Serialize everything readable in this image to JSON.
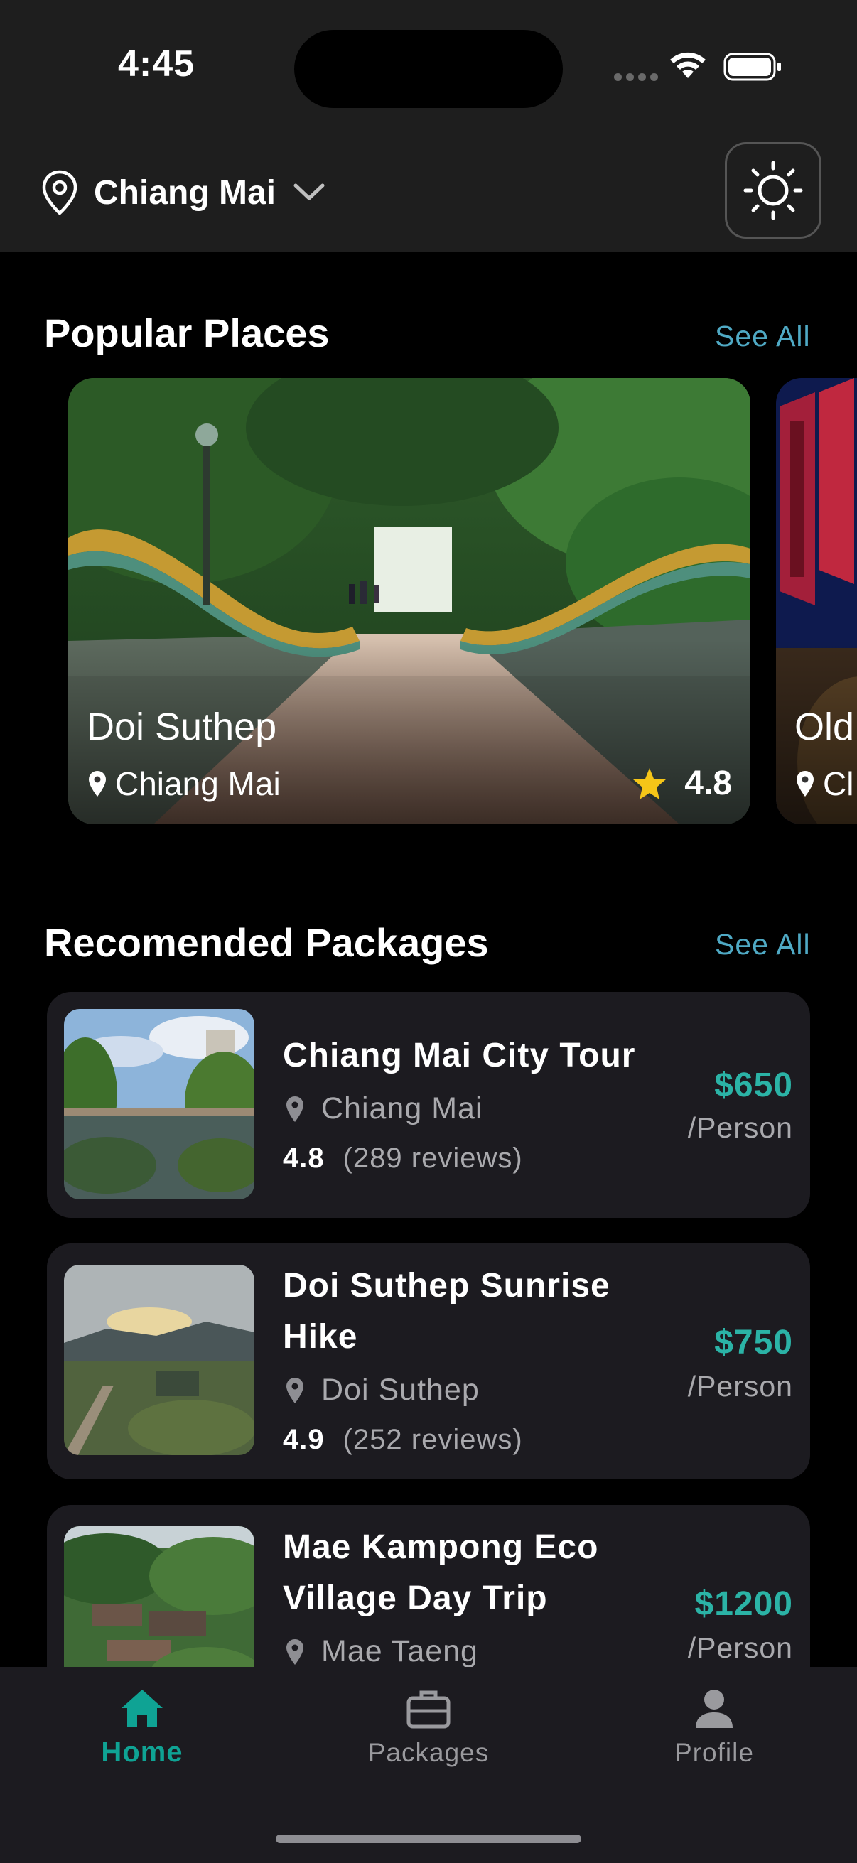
{
  "status_bar": {
    "time": "4:45"
  },
  "header": {
    "location": "Chiang Mai"
  },
  "popular": {
    "title": "Popular Places",
    "see_all": "See All",
    "places": [
      {
        "name": "Doi Suthep",
        "location": "Chiang Mai",
        "rating": "4.8"
      },
      {
        "name": "Old",
        "location": "Cl"
      }
    ]
  },
  "packages": {
    "title": "Recomended Packages",
    "see_all": "See All",
    "items": [
      {
        "title": "Chiang Mai City Tour",
        "location": "Chiang Mai",
        "rating": "4.8",
        "reviews": "(289 reviews)",
        "price": "$650",
        "per": "/Person"
      },
      {
        "title": "Doi Suthep Sunrise Hike",
        "location": "Doi Suthep",
        "rating": "4.9",
        "reviews": "(252 reviews)",
        "price": "$750",
        "per": "/Person"
      },
      {
        "title": "Mae Kampong Eco Village Day Trip",
        "location": "Mae Taeng",
        "price": "$1200",
        "per": "/Person"
      }
    ]
  },
  "nav": {
    "home": "Home",
    "packages": "Packages",
    "profile": "Profile"
  },
  "colors": {
    "accent": "#0fa394",
    "price": "#2bb3a6",
    "link": "#4fa9c4",
    "star": "#f5c518",
    "card": "#1c1b20",
    "header": "#1e1e1e"
  },
  "icons": [
    "location-pin-icon",
    "chevron-down-icon",
    "sun-icon",
    "star-icon",
    "home-icon",
    "briefcase-icon",
    "person-icon",
    "wifi-icon",
    "battery-icon"
  ]
}
